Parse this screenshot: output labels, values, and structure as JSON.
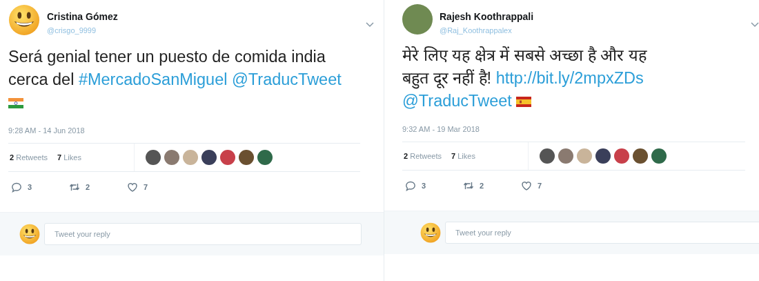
{
  "tweets": [
    {
      "avatar": {
        "kind": "emoji"
      },
      "name": "Cristina Gómez",
      "handle": "@crisgo_9999",
      "lines": [
        [
          {
            "kind": "text",
            "text": "Será genial tener un puesto de comida india"
          }
        ],
        [
          {
            "kind": "text",
            "text": "cerca del "
          },
          {
            "kind": "hashtag",
            "text": "#MercadoSanMiguel"
          },
          {
            "kind": "space"
          },
          {
            "kind": "mention",
            "text": "@TraducTweet"
          }
        ],
        [
          {
            "kind": "india_flag"
          }
        ]
      ],
      "timestamp": "9:28 AM - 14 Jun 2018",
      "retweets_count": "2",
      "retweets_label": "Retweets",
      "likes_count": "7",
      "likes_label": "Likes",
      "actions": [
        {
          "kind": "reply",
          "count": "3"
        },
        {
          "kind": "retweet",
          "count": "2"
        },
        {
          "kind": "like",
          "count": "7"
        }
      ],
      "reply_placeholder": "Tweet your reply"
    },
    {
      "avatar": {
        "kind": "photo"
      },
      "name": "Rajesh Koothrappali",
      "handle": "@Raj_Koothrappalex",
      "lines": [
        [
          {
            "kind": "text",
            "text": "मेरे लिए यह क्षेत्र में सबसे अच्छा है और यह"
          }
        ],
        [
          {
            "kind": "text",
            "text": "बहुत दूर नहीं है! "
          },
          {
            "kind": "url",
            "text": "http://bit.ly/2mpxZDs"
          }
        ],
        [
          {
            "kind": "mention",
            "text": "@TraducTweet"
          },
          {
            "kind": "space"
          },
          {
            "kind": "spain_flag"
          }
        ]
      ],
      "timestamp": "9:32 AM - 19 Mar 2018",
      "retweets_count": "2",
      "retweets_label": "Retweets",
      "likes_count": "7",
      "likes_label": "Likes",
      "actions": [
        {
          "kind": "reply",
          "count": "3"
        },
        {
          "kind": "retweet",
          "count": "2"
        },
        {
          "kind": "like",
          "count": "7"
        }
      ],
      "reply_placeholder": "Tweet your reply"
    }
  ]
}
